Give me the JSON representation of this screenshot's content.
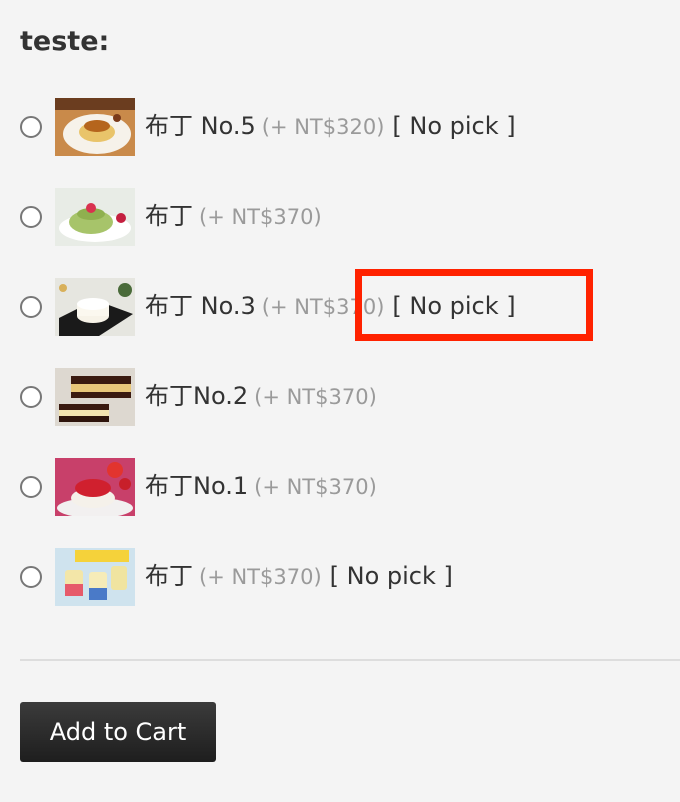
{
  "section": {
    "title": "teste:"
  },
  "options": [
    {
      "name": "布丁 No.5",
      "price": "(+ NT$320)",
      "no_pick": "[ No pick ]",
      "image": "pudding-plate-icon"
    },
    {
      "name": "布丁",
      "price": "(+ NT$370)",
      "no_pick": "",
      "image": "matcha-pudding-icon"
    },
    {
      "name": "布丁 No.3",
      "price": "(+ NT$370)",
      "no_pick": "[ No pick ]",
      "image": "panna-cotta-icon"
    },
    {
      "name": "布丁No.2",
      "price": "(+ NT$370)",
      "no_pick": "",
      "image": "layer-cake-icon"
    },
    {
      "name": "布丁No.1",
      "price": "(+ NT$370)",
      "no_pick": "",
      "image": "strawberry-jelly-icon"
    },
    {
      "name": "布丁",
      "price": "(+ NT$370)",
      "no_pick": "[ No pick ]",
      "image": "pudding-jars-icon"
    }
  ],
  "cart": {
    "button_label": "Add to Cart"
  },
  "colors": {
    "background": "#f4f4f4",
    "highlight": "#ff2200",
    "price_text": "#9a9a9a",
    "button": "#2a2a2a"
  }
}
